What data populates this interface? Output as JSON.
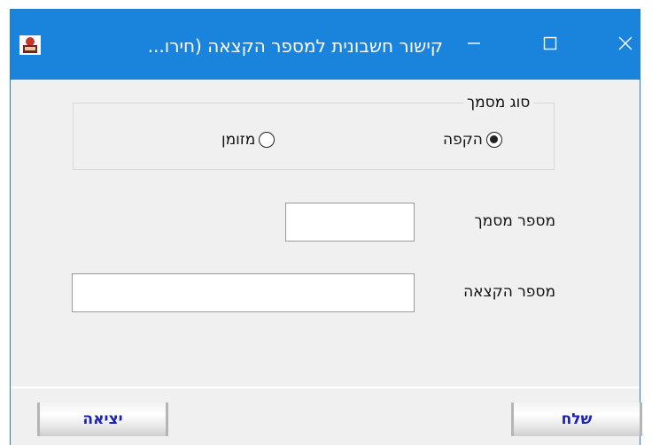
{
  "window": {
    "title": "קישור חשבונית למספר הקצאה (חירו...",
    "app_icon": "app-logo-icon",
    "controls": {
      "minimize": "minimize-icon",
      "maximize": "maximize-icon",
      "close": "close-icon"
    }
  },
  "document_type": {
    "label": "סוג מסמך",
    "options": [
      {
        "label": "הקפה",
        "selected": true
      },
      {
        "label": "מזומן",
        "selected": false
      }
    ]
  },
  "fields": {
    "document_number": {
      "label": "מספר מסמך",
      "value": ""
    },
    "allocation_number": {
      "label": "מספר הקצאה",
      "value": ""
    }
  },
  "buttons": {
    "send": "שלח",
    "exit": "יציאה"
  },
  "colors": {
    "titlebar": "#1a83dc",
    "button_text": "#1a22b8"
  }
}
